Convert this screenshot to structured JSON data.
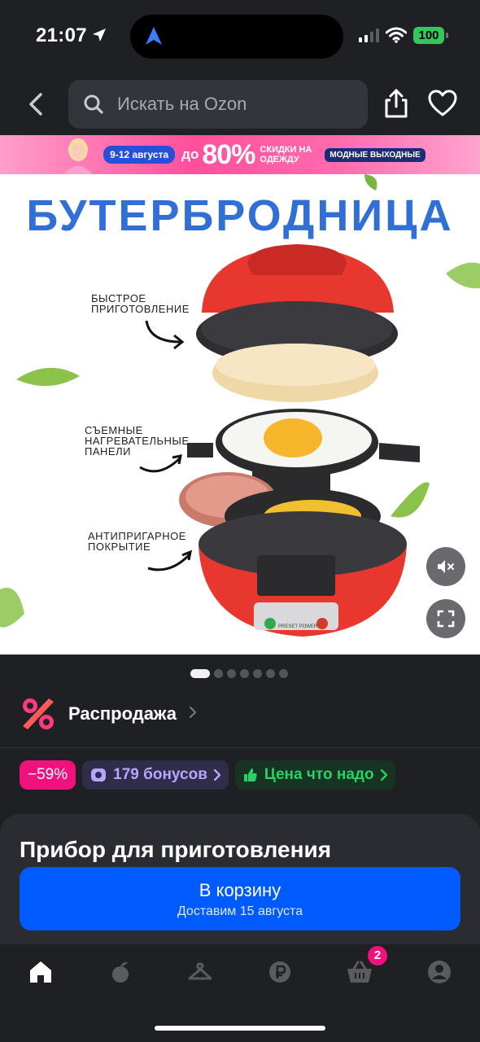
{
  "status": {
    "time": "21:07",
    "battery": "100"
  },
  "header": {
    "search_placeholder": "Искать на Ozon"
  },
  "banner": {
    "dates": "9-12 августа",
    "up_to": "до",
    "percent": "80%",
    "discount_text": "СКИДКИ НА ОДЕЖДУ",
    "fashion": "МОДНЫЕ ВЫХОДНЫЕ"
  },
  "product_image": {
    "title": "БУТЕРБРОДНИЦА",
    "label_1": "БЫСТРОЕ ПРИГОТОВЛЕНИЕ",
    "label_2": "СЪЕМНЫЕ НАГРЕВАТЕЛЬНЫЕ ПАНЕЛИ",
    "label_3": "АНТИПРИГАРНОЕ ПОКРЫТИЕ",
    "device_text": "PRESET POWER",
    "total_slides": 7,
    "active_slide": 1
  },
  "sale": {
    "label": "Распродажа"
  },
  "badges": {
    "discount": "−59%",
    "bonus": "179 бонусов",
    "price": "Цена что надо"
  },
  "card": {
    "title": "Прибор для приготовления",
    "cart_label": "В корзину",
    "delivery": "Доставим 15 августа"
  },
  "tabbar": {
    "cart_count": "2"
  },
  "colors": {
    "accent": "#005bff",
    "discount": "#f1117e",
    "price_green": "#25d366"
  }
}
